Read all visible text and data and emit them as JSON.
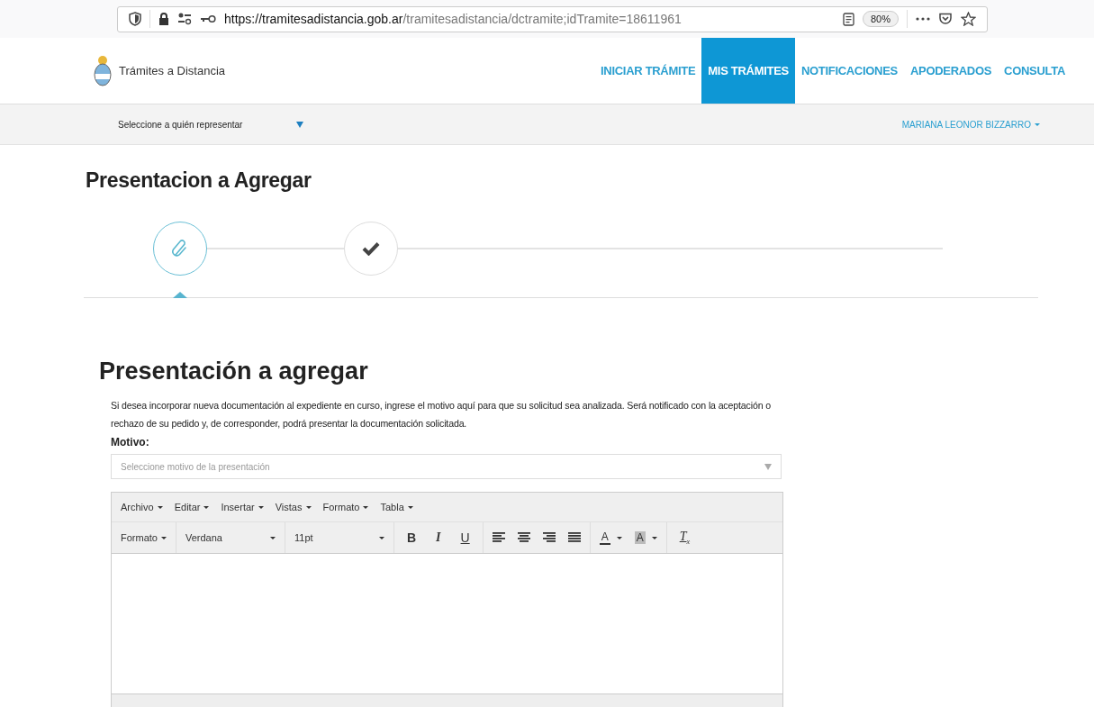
{
  "browser": {
    "url_domain": "https://tramitesadistancia.gob.ar",
    "url_path": "/tramitesadistancia/dctramite;idTramite=18611961",
    "zoom": "80%"
  },
  "site": {
    "name": "Trámites a Distancia",
    "nav": [
      {
        "label": "INICIAR TRÁMITE",
        "selected": false
      },
      {
        "label": "MIS TRÁMITES",
        "selected": true
      },
      {
        "label": "NOTIFICACIONES",
        "selected": false
      },
      {
        "label": "APODERADOS",
        "selected": false
      },
      {
        "label": "CONSULTA",
        "selected": false
      }
    ],
    "represent": "Seleccione a quién representar",
    "user": "MARIANA LEONOR BIZZARRO"
  },
  "page_title": "Presentacion a Agregar",
  "steps": [
    {
      "kind": "attachment",
      "selected": true
    },
    {
      "kind": "check",
      "selected": false
    }
  ],
  "form": {
    "heading": "Presentación a agregar",
    "description": "Si desea incorporar nueva documentación al expediente en curso, ingrese el motivo aquí para que su solicitud sea analizada. Será notificado con la aceptación o rechazo de su pedido y, de corresponder, podrá presentar la documentación solicitada.",
    "motivo_label": "Motivo:",
    "motivo_placeholder": "Seleccione motivo de la presentación",
    "editor": {
      "menus": [
        "Archivo",
        "Editar",
        "Insertar",
        "Vistas",
        "Formato",
        "Tabla"
      ],
      "toolbar": [
        {
          "kind": "dropdown",
          "label": "Formato"
        },
        {
          "kind": "dropdown",
          "label": "Verdana"
        },
        {
          "kind": "dropdown",
          "label": "11pt"
        },
        {
          "kind": "bold",
          "label": "B"
        },
        {
          "kind": "italic",
          "label": "I"
        },
        {
          "kind": "underline",
          "label": "U"
        },
        {
          "kind": "alignleft"
        },
        {
          "kind": "aligncenter"
        },
        {
          "kind": "alignright"
        },
        {
          "kind": "justify"
        },
        {
          "kind": "textcolor",
          "label": "A"
        },
        {
          "kind": "highlight",
          "label": "A"
        },
        {
          "kind": "clear",
          "label": "T",
          "sub": "x"
        }
      ]
    }
  }
}
